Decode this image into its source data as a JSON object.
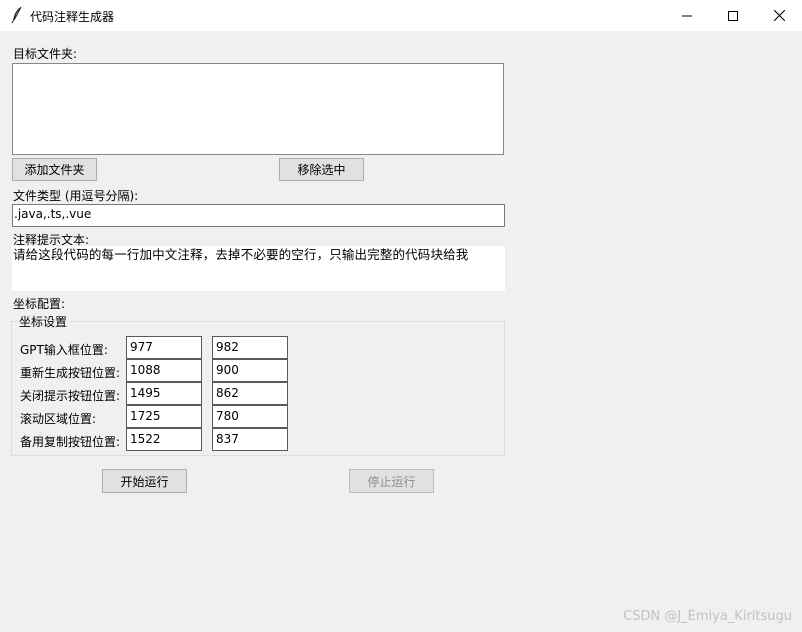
{
  "window": {
    "title": "代码注释生成器",
    "icon": "feather-icon",
    "controls": [
      "minimize-icon",
      "maximize-icon",
      "close-icon"
    ]
  },
  "folder_section": {
    "label": "目标文件夹:",
    "items": []
  },
  "buttons": {
    "add_folder": "添加文件夹",
    "remove_selected": "移除选中",
    "start": "开始运行",
    "stop": "停止运行"
  },
  "file_types": {
    "label": "文件类型 (用逗号分隔):",
    "value": ".java,.ts,.vue"
  },
  "prompt": {
    "label": "注释提示文本:",
    "value": "请给这段代码的每一行加中文注释，去掉不必要的空行，只输出完整的代码块给我"
  },
  "coords": {
    "section_label": "坐标配置:",
    "group_title": "坐标设置",
    "rows": [
      {
        "label": "GPT输入框位置:",
        "x": "977",
        "y": "982"
      },
      {
        "label": "重新生成按钮位置:",
        "x": "1088",
        "y": "900"
      },
      {
        "label": "关闭提示按钮位置:",
        "x": "1495",
        "y": "862"
      },
      {
        "label": "滚动区域位置:",
        "x": "1725",
        "y": "780"
      },
      {
        "label": "备用复制按钮位置:",
        "x": "1522",
        "y": "837"
      }
    ]
  },
  "watermark": "CSDN @J_Emiya_Kiritsugu",
  "colors": {
    "window_bg": "#f0f0f0",
    "titlebar_bg": "#ffffff",
    "button_bg": "#e1e1e1",
    "disabled_text": "#8d8d8d"
  }
}
